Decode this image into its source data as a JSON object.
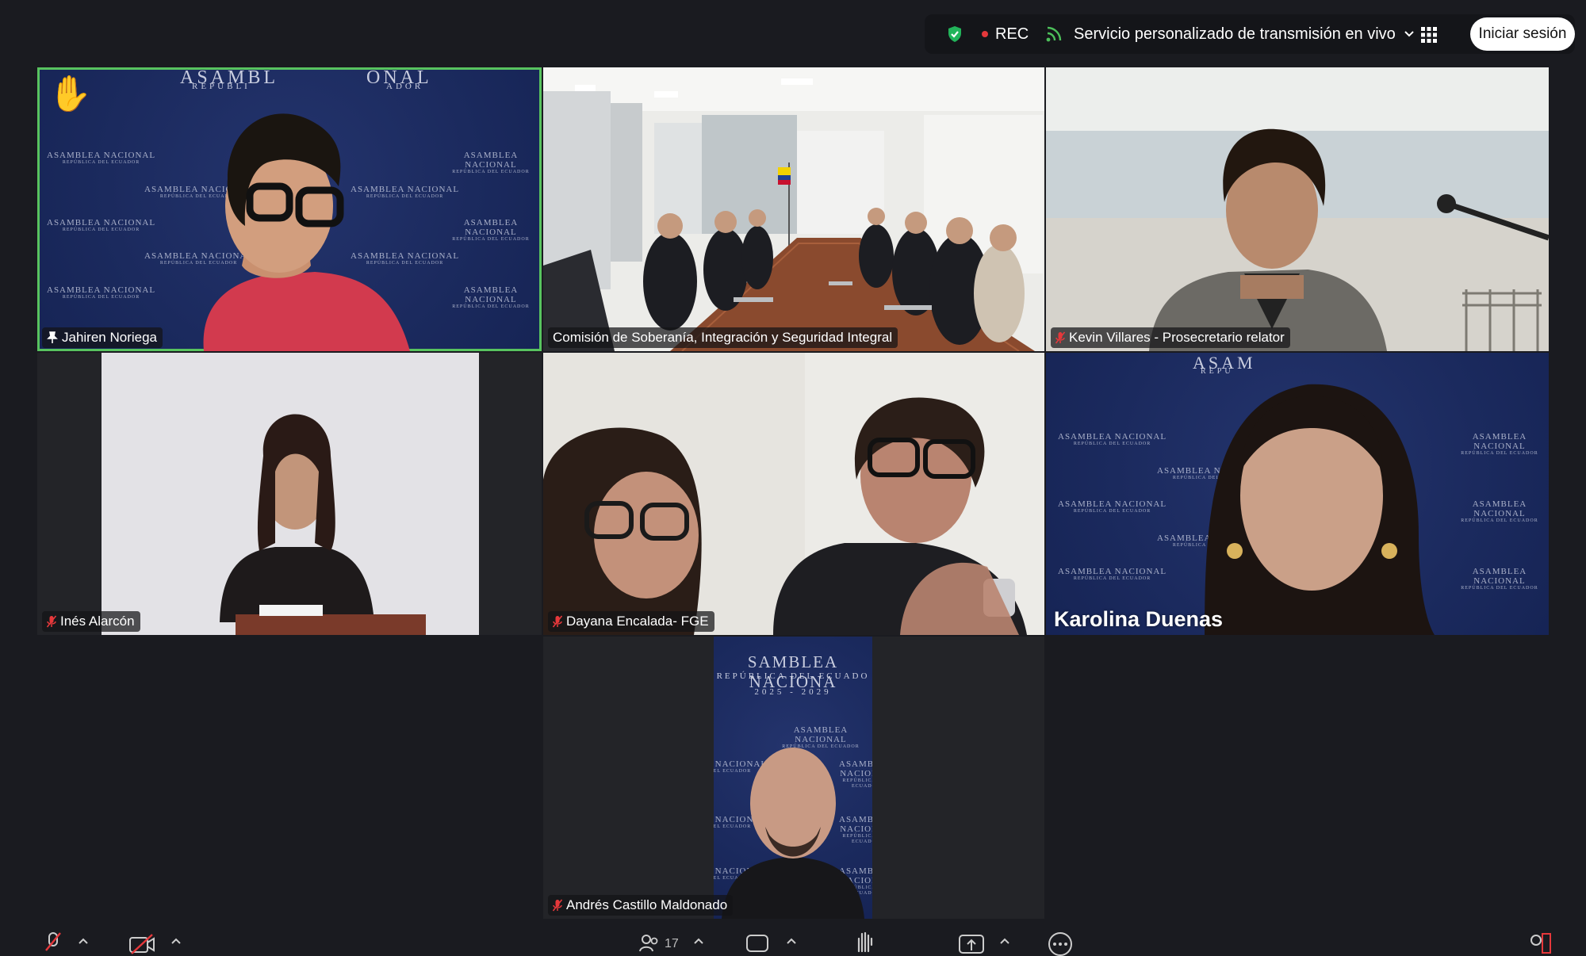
{
  "topbar": {
    "rec_label": "REC",
    "live_label": "Servicio personalizado de transmisión en vivo",
    "signin_label": "Iniciar sesión"
  },
  "participants": [
    {
      "name": "Jahiren Noriega",
      "status": "pinned",
      "active_speaker": true,
      "hand_raised": true
    },
    {
      "name": "Comisión de Soberanía, Integración y Seguridad Integral",
      "status": "none"
    },
    {
      "name": "Kevin Villares - Prosecretario relator",
      "status": "muted"
    },
    {
      "name": "Inés Alarcón",
      "status": "muted"
    },
    {
      "name": "Dayana Encalada- FGE",
      "status": "muted"
    },
    {
      "name": "Karolina Duenas",
      "status": "none"
    },
    {
      "name": "Andrés Castillo Maldonado",
      "status": "muted"
    }
  ],
  "backdrop": {
    "org": "ASAMBLEA NACIONAL",
    "subtitle": "REPÚBLICA DEL ECUADOR",
    "period": "2025 - 2029",
    "header_top_left": "ASAMBL",
    "header_top_right": "ONAL",
    "header_sub_left": "REPÚBLI",
    "header_sub_right": "ADOR",
    "header_karolina": "ASAM",
    "header_karolina_sub": "REPÚ",
    "andres_title": "SAMBLEA NACIONA",
    "andres_sub": "REPÚBLICA DEL ECUADO"
  },
  "toolbar": {
    "participants_count": "17"
  },
  "colors": {
    "app_bg": "#1a1b20",
    "active_speaker": "#58c35f",
    "rec_dot": "#e5383b",
    "mute_red": "#e5383b",
    "backdrop_blue": "#1b2a5e"
  }
}
